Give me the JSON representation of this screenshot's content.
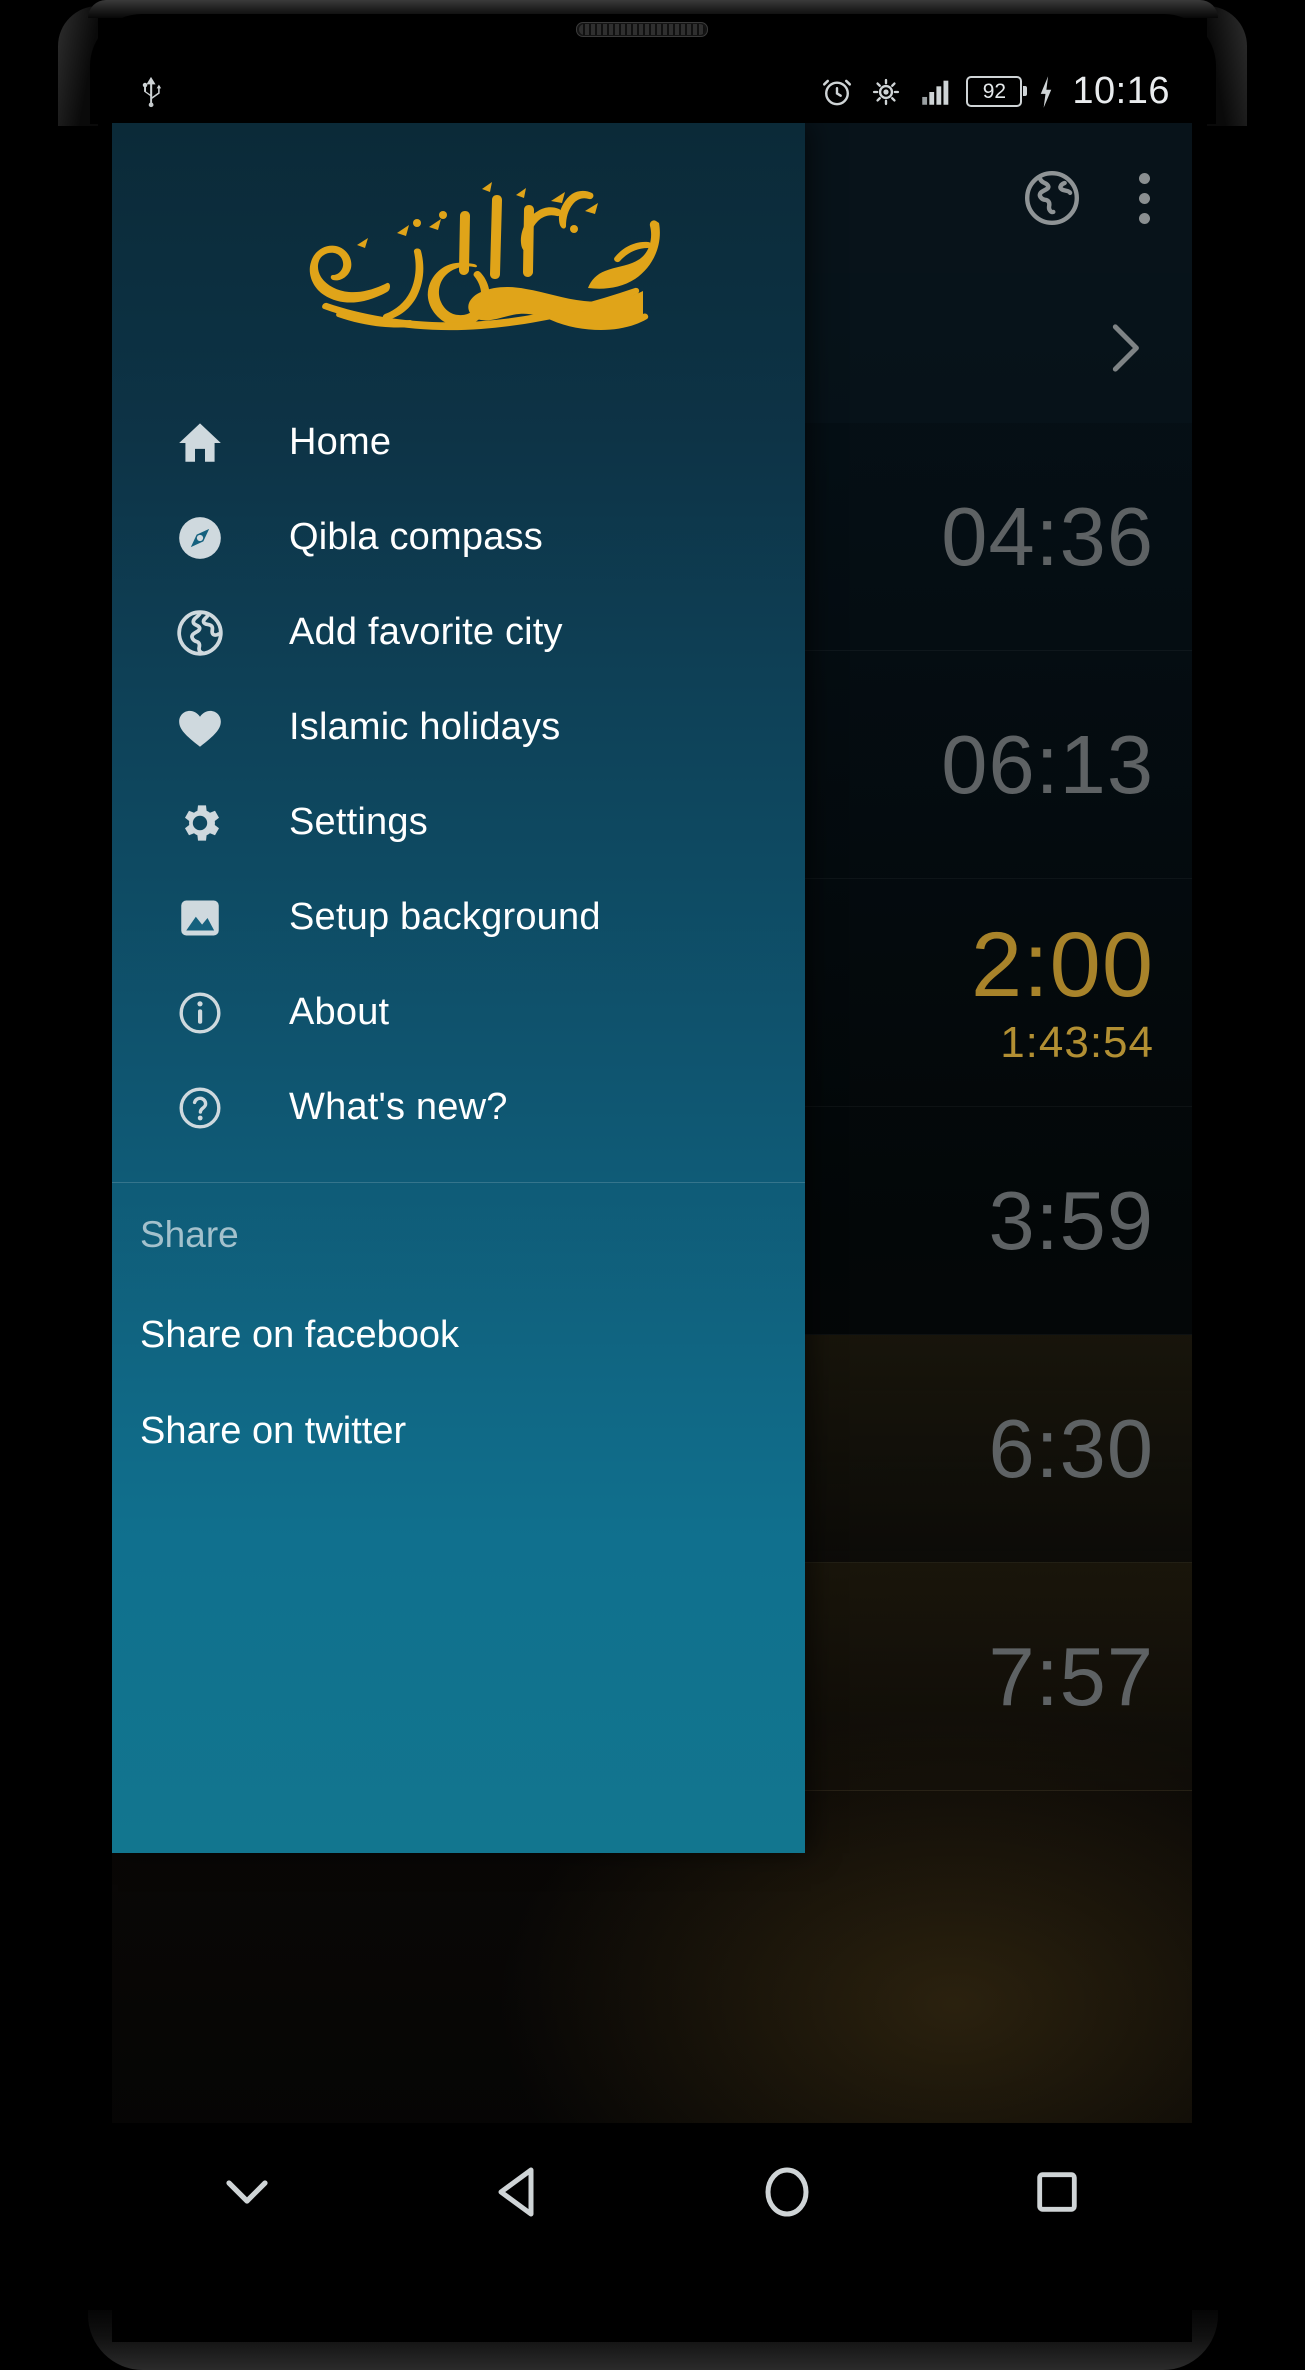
{
  "statusbar": {
    "left_icons": [
      "usb-icon"
    ],
    "right_icons": [
      "alarm-icon",
      "eye-care-icon",
      "signal-icon",
      "battery-icon",
      "charging-icon"
    ],
    "battery_level": "92",
    "time": "10:16"
  },
  "background_app": {
    "toolbar_icons": [
      "globe-icon",
      "overflow-menu-icon"
    ],
    "expand_icon": "chevron-right-icon",
    "prayer_times": [
      {
        "time": "04:36",
        "active": false
      },
      {
        "time": "06:13",
        "active": false
      },
      {
        "time": "2:00",
        "countdown": "1:43:54",
        "active": true
      },
      {
        "time": "3:59",
        "active": false
      },
      {
        "time": "6:30",
        "active": false
      },
      {
        "time": "7:57",
        "active": false
      }
    ]
  },
  "drawer": {
    "header": {
      "calligraphy_label": "Bismillah ar-Rahman ar-Raheem",
      "calligraphy_color": "#e0a419"
    },
    "items": [
      {
        "label": "Home",
        "icon": "home-icon"
      },
      {
        "label": "Qibla compass",
        "icon": "compass-icon"
      },
      {
        "label": "Add favorite city",
        "icon": "globe-icon"
      },
      {
        "label": "Islamic holidays",
        "icon": "heart-icon"
      },
      {
        "label": "Settings",
        "icon": "gear-icon"
      },
      {
        "label": "Setup background",
        "icon": "image-icon"
      },
      {
        "label": "About",
        "icon": "info-icon"
      },
      {
        "label": "What's new?",
        "icon": "help-icon"
      }
    ],
    "share_section": {
      "title": "Share",
      "items": [
        {
          "label": "Share on facebook"
        },
        {
          "label": "Share on twitter"
        }
      ]
    },
    "colors": {
      "top": "#0b2a38",
      "bottom": "#12768f",
      "text": "#ffffff"
    }
  },
  "navbar": {
    "buttons": [
      {
        "name": "hide-keyboard-button",
        "icon": "chevron-down-icon"
      },
      {
        "name": "back-button",
        "icon": "triangle-left-icon"
      },
      {
        "name": "home-button",
        "icon": "circle-icon"
      },
      {
        "name": "recents-button",
        "icon": "square-icon"
      }
    ]
  }
}
